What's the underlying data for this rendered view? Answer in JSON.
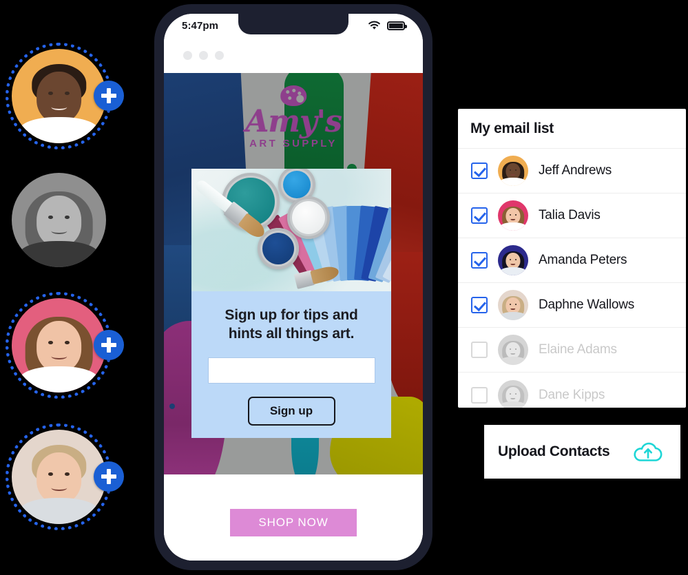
{
  "phone": {
    "status": {
      "time": "5:47pm",
      "wifi_icon": "wifi-icon",
      "battery_icon": "battery-icon"
    },
    "browser_dots": [
      "dot",
      "dot",
      "dot"
    ],
    "site": {
      "logo": {
        "name": "Amy's",
        "tagline": "ART SUPPLY",
        "icon": "paint-palette-icon",
        "color": "#8e3f8c"
      },
      "hero_image": "paint-cans-and-brushes-photo",
      "signup": {
        "heading": "Sign up for tips and hints all things art.",
        "email_value": "",
        "email_placeholder": "",
        "button_label": "Sign up",
        "card_color": "#bcd9f8"
      },
      "shop_button": {
        "label": "SHOP NOW",
        "color": "#dd8ad6"
      }
    }
  },
  "avatars": [
    {
      "name": "avatar-1",
      "bg": "#f0ad51",
      "ring": true,
      "plus": true,
      "gray": false,
      "hair": "#2a1c14",
      "skin": "#6b4630",
      "shirt": "#ffffff"
    },
    {
      "name": "avatar-2",
      "bg": "#8e8e8e",
      "ring": false,
      "plus": false,
      "gray": true,
      "hair": "#6b5a49",
      "skin": "#d8b295",
      "shirt": "#2f2f2f"
    },
    {
      "name": "avatar-3",
      "bg": "#e35f7e",
      "ring": true,
      "plus": true,
      "gray": false,
      "hair": "#7a5130",
      "skin": "#f0c3a6",
      "shirt": "#ffffff"
    },
    {
      "name": "avatar-4",
      "bg": "#e4d6cc",
      "ring": true,
      "plus": true,
      "gray": false,
      "hair": "#c9ae84",
      "skin": "#f0c7ab",
      "shirt": "#d9dde1"
    }
  ],
  "email_list": {
    "title": "My email list",
    "rows": [
      {
        "name": "Jeff Andrews",
        "checked": true,
        "disabled": false,
        "bg": "#f0ad51",
        "hair": "#2a1c14",
        "skin": "#6b4630",
        "shirt": "#ffffff"
      },
      {
        "name": "Talia Davis",
        "checked": true,
        "disabled": false,
        "bg": "#e0376b",
        "hair": "#8a6034",
        "skin": "#f2c6a8",
        "shirt": "#ffffff"
      },
      {
        "name": "Amanda Peters",
        "checked": true,
        "disabled": false,
        "bg": "#2c2a8c",
        "hair": "#141222",
        "skin": "#efc6a7",
        "shirt": "#e9eef4"
      },
      {
        "name": "Daphne Wallows",
        "checked": true,
        "disabled": false,
        "bg": "#e4d6cc",
        "hair": "#c9ae84",
        "skin": "#f0c7ab",
        "shirt": "#d9dde1"
      },
      {
        "name": "Elaine Adams",
        "checked": false,
        "disabled": true,
        "bg": "#9a9a9a",
        "hair": "#5d5d5d",
        "skin": "#c6c6c6",
        "shirt": "#b0b0b0"
      },
      {
        "name": "Dane Kipps",
        "checked": false,
        "disabled": true,
        "bg": "#9a9a9a",
        "hair": "#6a6a6a",
        "skin": "#c9c9c9",
        "shirt": "#b5b5b5"
      }
    ]
  },
  "upload": {
    "label": "Upload Contacts",
    "icon": "cloud-upload-icon",
    "icon_color": "#1ed6d6"
  },
  "swatch_colors": [
    "#8e2b52",
    "#d86fa0",
    "#8ecbe8",
    "#b7d6ef",
    "#9fc6ea",
    "#7fb3e4",
    "#4f8fd6",
    "#2b63bf",
    "#1d44a8",
    "#6fa8dc",
    "#a8c8e8",
    "#cddff0"
  ]
}
